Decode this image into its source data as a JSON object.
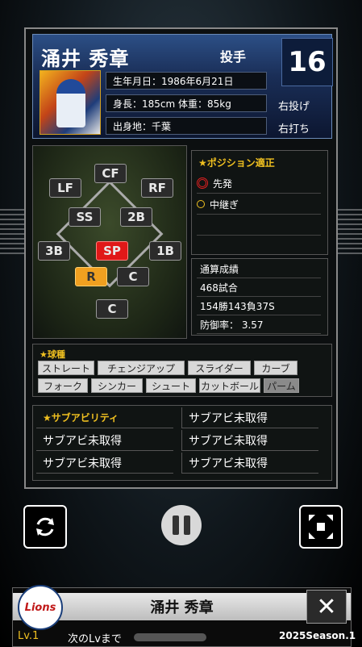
{
  "player": {
    "name": "涌井 秀章",
    "position": "投手",
    "number": "16",
    "birth": "生年月日：1986年6月21日",
    "body": "身長：185cm 体重：85kg",
    "birthplace": "出身地：千葉",
    "throws": "右投げ",
    "bats": "右打ち"
  },
  "field_positions": [
    "CF",
    "LF",
    "RF",
    "SS",
    "2B",
    "3B",
    "SP",
    "1B",
    "R",
    "C",
    "C"
  ],
  "aptitude": {
    "title": "★ポジション適正",
    "items": [
      {
        "label": "先発",
        "marker": "double-circle-red"
      },
      {
        "label": "中継ぎ",
        "marker": "circle-yellow"
      }
    ]
  },
  "stats": {
    "title": "通算成績",
    "games": "468試合",
    "record": "154勝143負37S",
    "era": "防御率： 3.57"
  },
  "pitches": {
    "title": "★球種",
    "items": [
      "ストレート",
      "チェンジアップ",
      "スライダー",
      "カーブ",
      "フォーク",
      "シンカー",
      "シュート",
      "カットボール",
      "パーム"
    ]
  },
  "sub_ability": {
    "title": "★サブアビリティ",
    "cells": [
      "サブアビ未取得",
      "サブアビ未取得",
      "サブアビ未取得",
      "サブアビ未取得",
      "サブアビ未取得"
    ]
  },
  "controls": {
    "refresh_icon": "refresh-icon",
    "pause_icon": "pause-icon",
    "collapse_icon": "collapse-arrows-icon"
  },
  "footer": {
    "team_logo": "Lions",
    "title": "涌井 秀章",
    "close": "✕",
    "level": "Lv.1",
    "next_level": "次のLvまで",
    "season": "2025Season.1"
  },
  "colors": {
    "accent_yellow": "#f0c020",
    "sp_red": "#e01818",
    "relief_orange": "#f0a020",
    "header_blue": "#2c4f86"
  }
}
